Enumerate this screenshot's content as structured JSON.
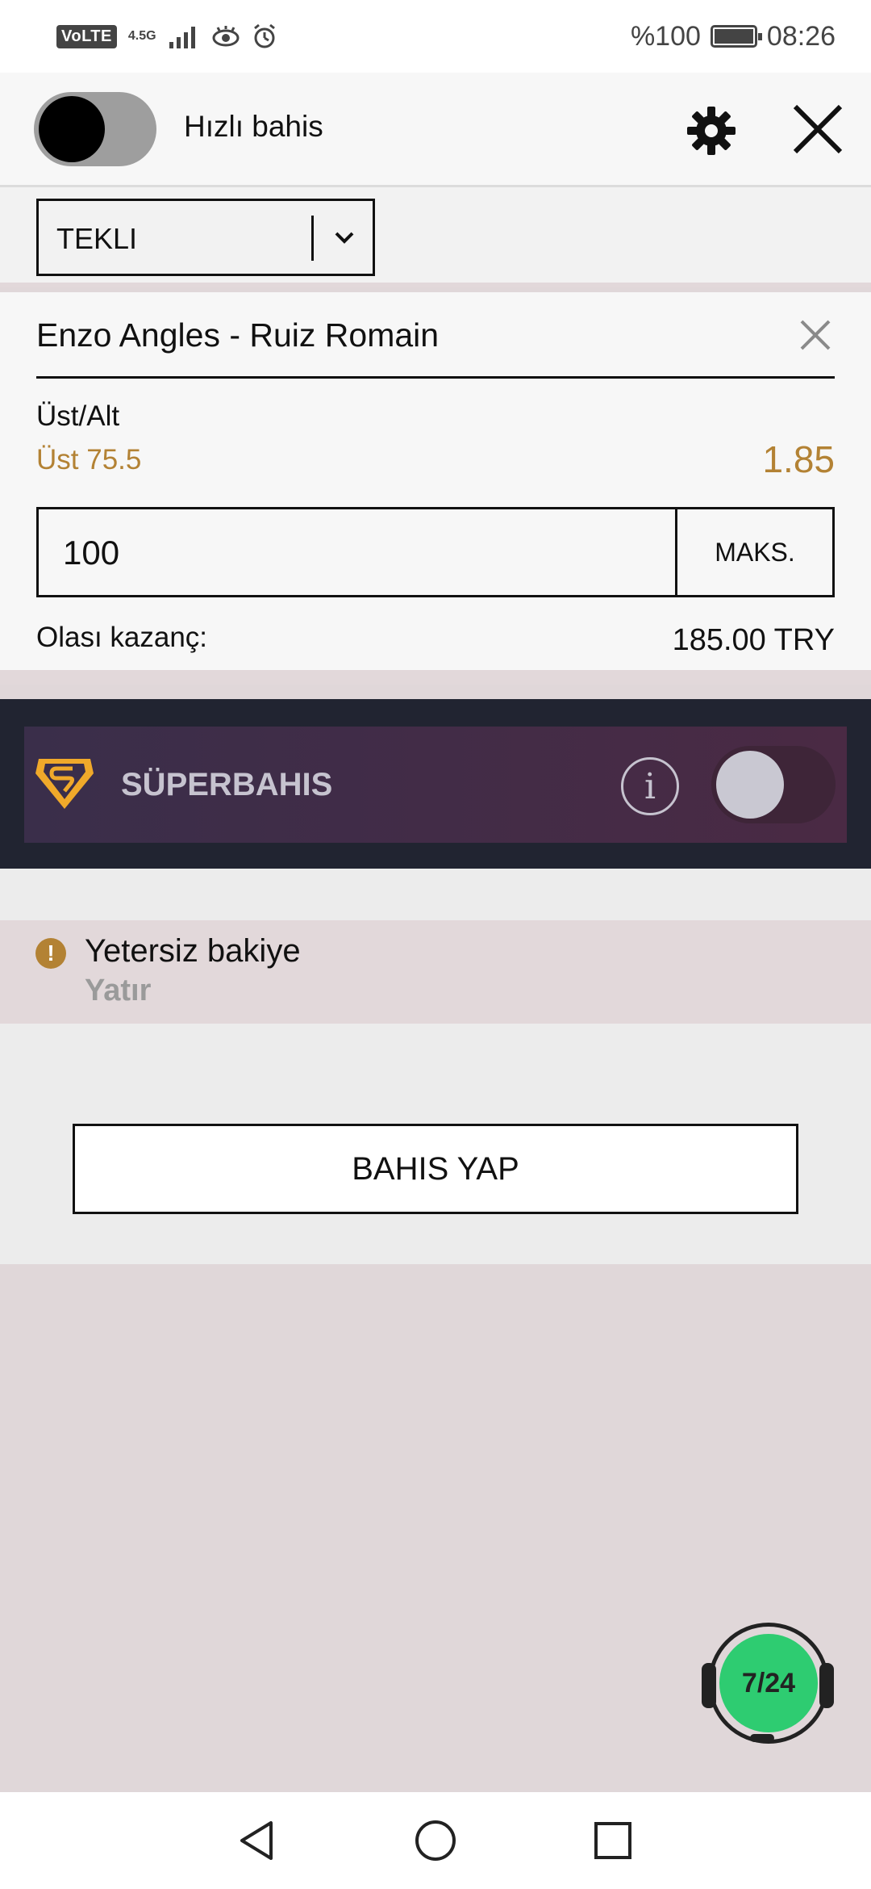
{
  "status_bar": {
    "volte": "VoLTE",
    "network": "4.5G",
    "battery_percent": "%100",
    "time": "08:26"
  },
  "header": {
    "quick_bet_label": "Hızlı bahis",
    "quick_bet_enabled": false
  },
  "bet_type": {
    "selected": "TEKLI"
  },
  "bet": {
    "match": "Enzo Angles - Ruiz Romain",
    "market": "Üst/Alt",
    "selection": "Üst 75.5",
    "odds": "1.85",
    "stake": "100",
    "max_label": "MAKS.",
    "potential_win_label": "Olası kazanç:",
    "potential_win_value": "185.00 TRY"
  },
  "superbahis": {
    "title": "SÜPERBAHIS",
    "enabled": false
  },
  "warning": {
    "message": "Yetersiz bakiye",
    "link": "Yatır"
  },
  "place_bet_label": "BAHIS YAP",
  "support": {
    "label": "7/24"
  },
  "colors": {
    "accent_gold": "#b38234",
    "super_bg": "#212431",
    "support_green": "#2ecc71"
  }
}
